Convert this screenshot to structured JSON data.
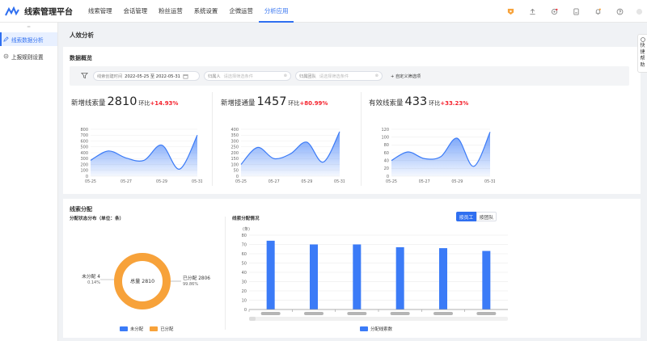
{
  "app": {
    "title": "线索管理平台"
  },
  "nav": [
    {
      "label": "线索管理",
      "active": false
    },
    {
      "label": "会话管理",
      "active": false
    },
    {
      "label": "粉丝运营",
      "active": false
    },
    {
      "label": "系统设置",
      "active": false
    },
    {
      "label": "企微运营",
      "active": false
    },
    {
      "label": "分析应用",
      "active": true
    }
  ],
  "sidebar": {
    "items": [
      {
        "label": "线索数据分析",
        "active": true
      },
      {
        "label": "上报规则设置",
        "active": false
      }
    ]
  },
  "page": {
    "title": "人效分析"
  },
  "overview": {
    "title": "数据概览",
    "filters": {
      "created_label": "线索创建时间",
      "date_range": "2022-05-25 至 2022-05-31",
      "owner_label": "归属人",
      "owner_placeholder": "请选择筛选条件",
      "team_label": "归属团队",
      "team_placeholder": "请选择筛选条件",
      "custom_label": "+ 自定义筛选项"
    },
    "kpis": [
      {
        "label": "新增线索量",
        "value": "2810",
        "compare": "环比",
        "pct": "+14.93%"
      },
      {
        "label": "新增接通量",
        "value": "1457",
        "compare": "环比",
        "pct": "+80.99%"
      },
      {
        "label": "有效线索量",
        "value": "433",
        "compare": "环比",
        "pct": "+33.23%"
      }
    ]
  },
  "distribution": {
    "title": "线索分配",
    "status_title": "分配状态分布（单位：条）",
    "donut": {
      "center_label": "总量 2810",
      "unassigned": {
        "label": "未分配 4",
        "pct": "0.14%"
      },
      "assigned": {
        "label": "已分配 2806",
        "pct": "99.86%"
      }
    },
    "donut_legend": [
      "未分配",
      "已分配"
    ],
    "bar_title": "线索分配情况",
    "toggle": {
      "employee": "按员工",
      "team": "按团队"
    },
    "bar_legend": "分配线索数"
  },
  "colors": {
    "accent": "#2f6ff0",
    "orange": "#f7a23a",
    "bar": "#3b7bf7",
    "up": "#f5222d"
  },
  "chart_data": [
    {
      "type": "area",
      "title": "新增线索量",
      "x": [
        "05-25",
        "05-26",
        "05-27",
        "05-28",
        "05-29",
        "05-30",
        "05-31"
      ],
      "xticks": [
        "05-25",
        "05-27",
        "05-29",
        "05-31"
      ],
      "values": [
        270,
        430,
        310,
        270,
        530,
        120,
        700
      ],
      "ylim": [
        0,
        800
      ],
      "yticks": [
        0,
        100,
        200,
        300,
        400,
        500,
        600,
        700,
        800
      ]
    },
    {
      "type": "area",
      "title": "新增接通量",
      "x": [
        "05-25",
        "05-26",
        "05-27",
        "05-28",
        "05-29",
        "05-30",
        "05-31"
      ],
      "xticks": [
        "05-25",
        "05-27",
        "05-29",
        "05-31"
      ],
      "values": [
        100,
        245,
        150,
        190,
        290,
        120,
        380
      ],
      "ylim": [
        0,
        400
      ],
      "yticks": [
        0,
        50,
        100,
        150,
        200,
        250,
        300,
        350,
        400
      ]
    },
    {
      "type": "area",
      "title": "有效线索量",
      "x": [
        "05-25",
        "05-26",
        "05-27",
        "05-28",
        "05-29",
        "05-30",
        "05-31"
      ],
      "xticks": [
        "05-25",
        "05-27",
        "05-29",
        "05-31"
      ],
      "values": [
        40,
        62,
        45,
        50,
        97,
        25,
        113
      ],
      "ylim": [
        0,
        120
      ],
      "yticks": [
        0,
        20,
        40,
        60,
        80,
        100,
        120
      ]
    },
    {
      "type": "pie",
      "slices": [
        {
          "name": "未分配",
          "value": 4
        },
        {
          "name": "已分配",
          "value": 2806
        }
      ]
    },
    {
      "type": "bar",
      "ylabel": "(条)",
      "ylim": [
        0,
        80
      ],
      "yticks": [
        0,
        10,
        20,
        30,
        40,
        50,
        60,
        70,
        80
      ],
      "categories": [
        "",
        "",
        "",
        "",
        "",
        ""
      ],
      "series": [
        {
          "name": "分配线索数",
          "values": [
            74,
            70,
            70,
            67,
            66,
            63
          ]
        }
      ]
    }
  ]
}
